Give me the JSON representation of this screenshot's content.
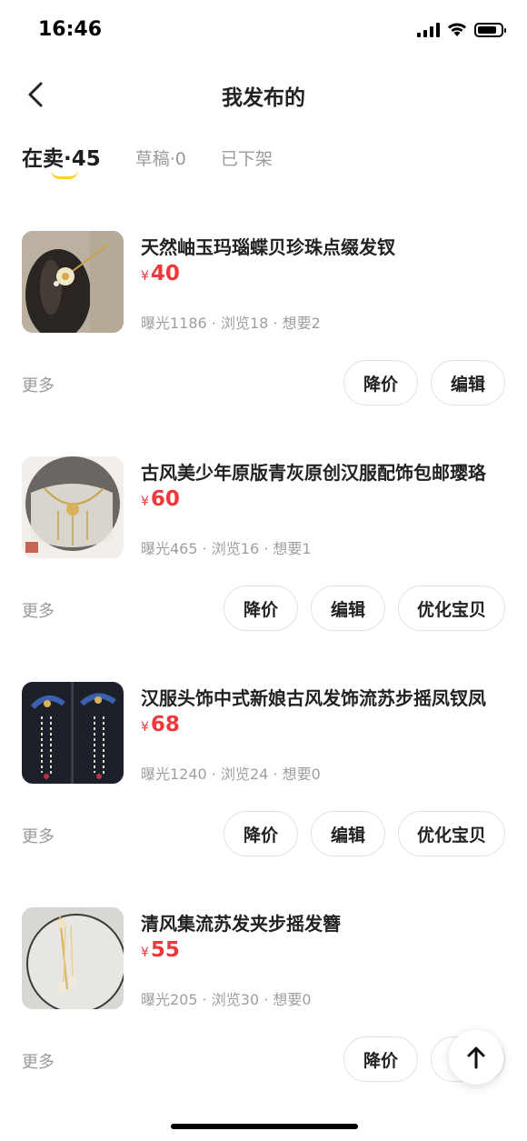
{
  "status_bar": {
    "time": "16:46",
    "battery_level": 0.85
  },
  "header": {
    "title": "我发布的"
  },
  "tabs": [
    {
      "label": "在卖·45",
      "active": true
    },
    {
      "label": "草稿·0",
      "active": false
    },
    {
      "label": "已下架",
      "active": false
    }
  ],
  "listings": [
    {
      "title": "天然岫玉玛瑙蝶贝珍珠点缀发钗",
      "currency": "¥",
      "price": "40",
      "stats": "曝光1186 · 浏览18 · 想要2",
      "more_label": "更多",
      "buttons": [
        "降价",
        "编辑"
      ]
    },
    {
      "title": "古风美少年原版青灰原创汉服配饰包邮璎珞",
      "currency": "¥",
      "price": "60",
      "stats": "曝光465 · 浏览16 · 想要1",
      "more_label": "更多",
      "buttons": [
        "降价",
        "编辑",
        "优化宝贝"
      ]
    },
    {
      "title": "汉服头饰中式新娘古风发饰流苏步摇凤钗凤",
      "currency": "¥",
      "price": "68",
      "stats": "曝光1240 · 浏览24 · 想要0",
      "more_label": "更多",
      "buttons": [
        "降价",
        "编辑",
        "优化宝贝"
      ]
    },
    {
      "title": "清风集流苏发夹步摇发簪",
      "currency": "¥",
      "price": "55",
      "stats": "曝光205 · 浏览30 · 想要0",
      "more_label": "更多",
      "buttons": [
        "降价",
        "编辑"
      ]
    }
  ],
  "colors": {
    "accent": "#ffd21e",
    "price": "#f0373c",
    "muted": "#9a9a9a"
  },
  "icons": {
    "back": "chevron-left-icon",
    "scroll_top": "arrow-up-icon"
  }
}
